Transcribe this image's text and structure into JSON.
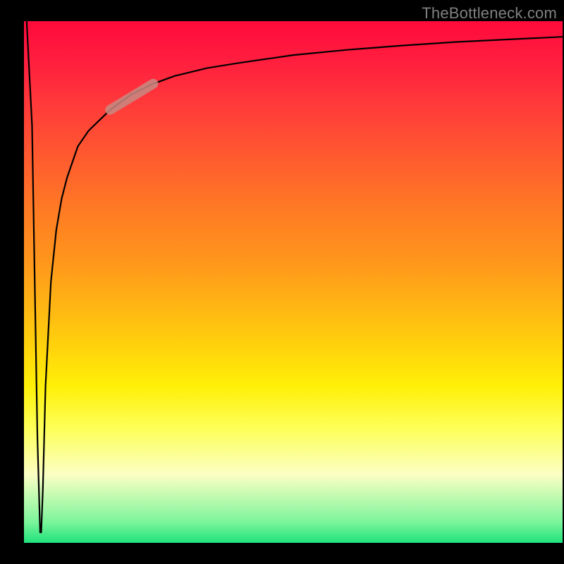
{
  "watermark": "TheBottleneck.com",
  "colors": {
    "background": "#000000",
    "watermark_text": "#808080",
    "gradient_top": "#ff0a3c",
    "gradient_bottom": "#1fe27c",
    "curve": "#000000",
    "marker": "#c88a83"
  },
  "chart_data": {
    "type": "line",
    "title": "",
    "xlabel": "",
    "ylabel": "",
    "xlim": [
      0,
      100
    ],
    "ylim": [
      0,
      100
    ],
    "background_gradient": {
      "direction": "vertical",
      "stops": [
        {
          "pos": 0,
          "color": "#ff0a3c"
        },
        {
          "pos": 50,
          "color": "#ffb314"
        },
        {
          "pos": 70,
          "color": "#fff008"
        },
        {
          "pos": 87,
          "color": "#fbffc4"
        },
        {
          "pos": 100,
          "color": "#1fe27c"
        }
      ]
    },
    "series": [
      {
        "name": "bottleneck-curve",
        "x": [
          0.5,
          1.5,
          2.0,
          2.5,
          3.0,
          3.2,
          3.5,
          4.0,
          5.0,
          6.0,
          7.0,
          8.0,
          10,
          12,
          14,
          16,
          18,
          20,
          24,
          28,
          34,
          40,
          50,
          60,
          70,
          80,
          90,
          100
        ],
        "y": [
          100,
          80,
          50,
          20,
          2,
          2,
          10,
          30,
          50,
          60,
          66,
          70,
          76,
          79,
          81,
          83,
          84.5,
          86,
          88,
          89.5,
          91,
          92,
          93.5,
          94.5,
          95.3,
          96,
          96.5,
          97
        ],
        "note": "y is percent height from bottom; curve dips to near 0 then asymptotes toward top"
      }
    ],
    "annotations": [
      {
        "name": "highlight-segment",
        "type": "line-segment",
        "x0": 16,
        "y0": 83,
        "x1": 24,
        "y1": 88,
        "color": "#c88a83",
        "thickness": 14
      }
    ]
  }
}
